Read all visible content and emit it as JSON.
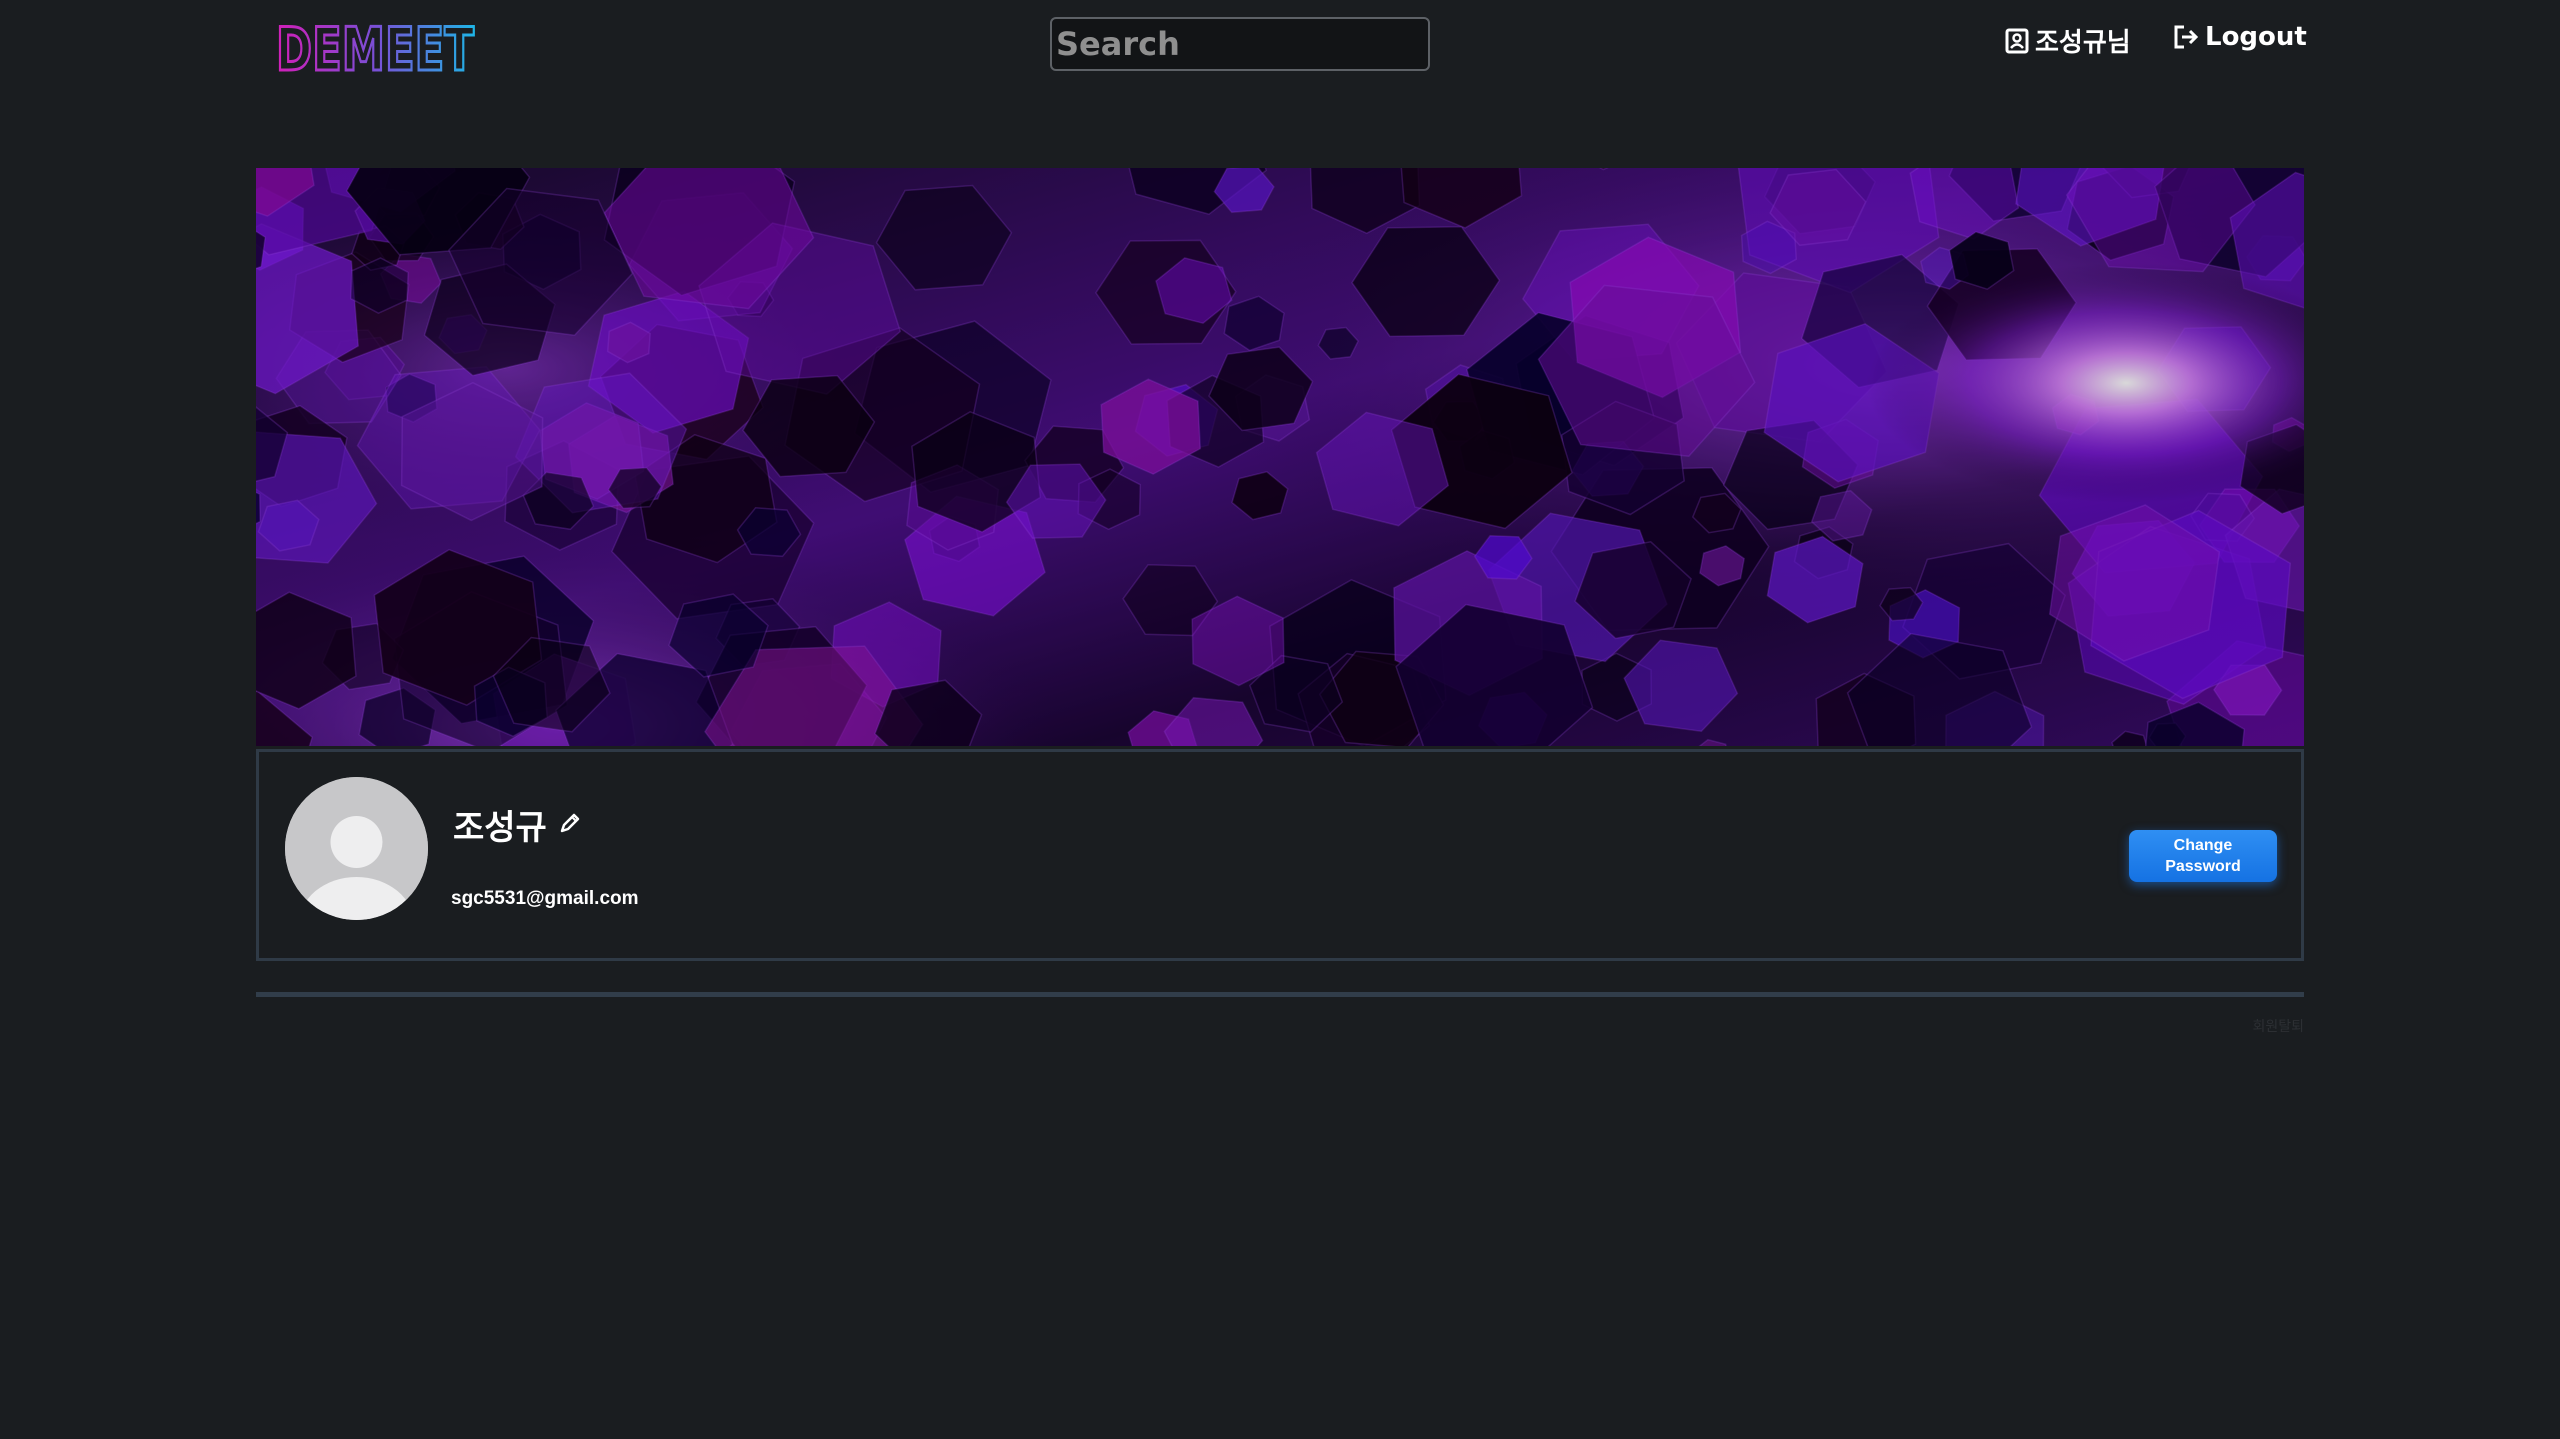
{
  "header": {
    "logo_text": "DEMEET",
    "search_placeholder": "Search",
    "user_label": "조성규님",
    "logout_label": "Logout"
  },
  "profile": {
    "name": "조성규",
    "email": "sgc5531@gmail.com",
    "change_password_label": "Change\nPassword"
  },
  "footer": {
    "withdraw_label": "회원탈퇴"
  },
  "colors": {
    "background": "#1a1d20",
    "card_border": "#2f3a46",
    "button_blue": "#1f7ff0",
    "logo_gradient": [
      "#d11fb8",
      "#7a4fd6",
      "#1fb4e6"
    ],
    "banner_purple": "#7a19d6"
  },
  "icons": {
    "user": "user-profile-icon",
    "logout": "logout-icon",
    "edit": "pencil-icon",
    "avatar": "default-avatar-icon"
  }
}
